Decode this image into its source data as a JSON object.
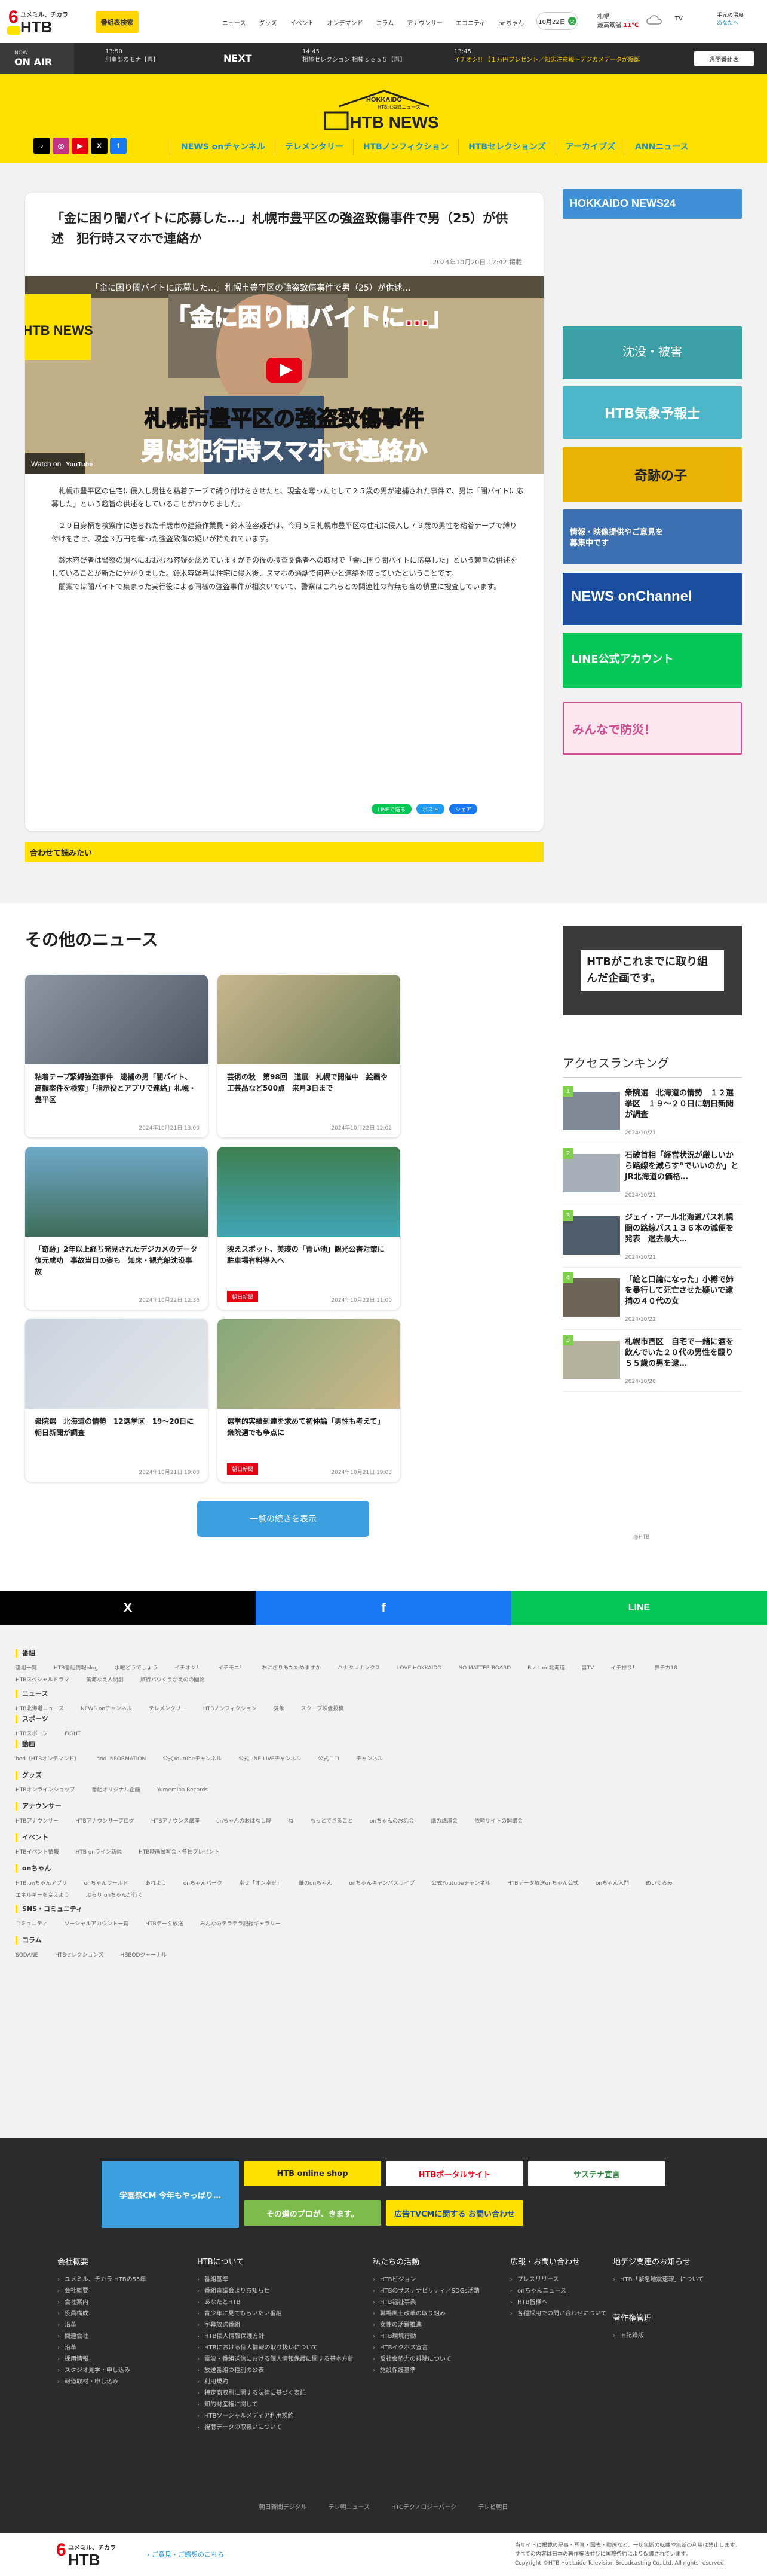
{
  "header": {
    "logo_small": "ユメミル、チカラ",
    "logo_main": "HTB",
    "subscribe_label": "番組表検索",
    "nav": [
      "ニュース",
      "グッズ",
      "イベント",
      "オンデマンド",
      "コラム",
      "アナウンサー",
      "エコニティ",
      "onちゃん"
    ],
    "date": "10月22日",
    "date_badge": "火",
    "weather_place": "札幌",
    "weather_label": "最高気温",
    "weather_temp": "11℃",
    "tv_label": "TV",
    "user_lines": [
      "手元の温度",
      "あなたへ"
    ]
  },
  "onair": {
    "now": "NOW",
    "label": "ON AIR",
    "current_time": "13:50",
    "current_title": "刑事部のモナ",
    "current_tag": "【再】",
    "next_label": "NEXT",
    "next_time": "14:45",
    "next_title": "相棒セレクション 相棒ｓｅａ５",
    "next_tag": "【再】",
    "ticker_time": "13:45",
    "ticker_text": "イチオシ!! 【１万円プレゼント／知床注意報～デジカメデータが爆誕",
    "schedule_button": "週間番組表"
  },
  "brand": {
    "hokkaido": "HOKKAIDO",
    "tagline": "HTB北海道ニュース",
    "newslogo": "HTB NEWS"
  },
  "social": [
    "tiktok",
    "instagram",
    "youtube",
    "x",
    "facebook"
  ],
  "mainnav": [
    "NEWS onチャンネル",
    "テレメンタリー",
    "HTBノンフィクション",
    "HTBセレクションズ",
    "アーカイブズ",
    "ANNニュース"
  ],
  "article": {
    "title": "「金に困り闇バイトに応募した…」札幌市豊平区の強盗致傷事件で男（25）が供述　犯行時スマホで連絡か",
    "date": "2024年10月20日 12:42 掲載",
    "video_title": "「金に困り闇バイトに応募した…」札幌市豊平区の強盗致傷事件で男（25）が供述…",
    "video_caption_top": "「金に困り闇バイトに…」",
    "video_caption_mid": "札幌市豊平区の強盗致傷事件",
    "video_caption_bottom": "男は犯行時スマホで連絡か",
    "video_watch": "Watch on",
    "video_youtube": "YouTube",
    "video_logo": "HTB NEWS",
    "paragraphs": [
      "札幌市豊平区の住宅に侵入し男性を粘着テープで縛り付けをさせたと、現金を奪ったとして２５歳の男が逮捕された事件で、男は「闇バイトに応募した」という趣旨の供述をしていることがわかりました。",
      "２０日身柄を検察庁に送られた千歳市の建築作業員・鈴木陸容疑者は、今月５日札幌市豊平区の住宅に侵入し７９歳の男性を粘着テープで縛り付けをさせ、現金３万円を奪った強盗致傷の疑いが持たれています。",
      "鈴木容疑者は警察の調べにおおむね容疑を認めていますがその後の捜査関係者への取材で「金に困り闇バイトに応募した」という趣旨の供述をしていることが新たに分かりました。鈴木容疑者は住宅に侵入後、スマホの通話で何者かと連絡を取っていたということです。",
      "闇案では闇バイトで集まった実行役による同様の強盗事件が相次いでいて、警察はこれらとの関連性の有無も含め慎重に捜査しています。"
    ],
    "share": [
      "LINEで送る",
      "ポスト",
      "シェア"
    ]
  },
  "related_label": "合わせて読みたい",
  "right_banners": [
    "HOKKAIDO NEWS24",
    "沈没・被害",
    "HTB気象予報士",
    "奇跡の子",
    "情報・映像提供やご意見を募集中です",
    "NEWS onChannel",
    "LINE公式アカウント",
    "みんなで防災！"
  ],
  "other": {
    "title": "その他のニュース",
    "more_button": "一覧の続きを表示",
    "cards": [
      {
        "title": "粘着テープ緊縛強盗事件　逮捕の男「闇バイト、高額案件を検索」「指示役とアプリで連絡」札幌・豊平区",
        "date": "2024年10月21日 13:00",
        "tag": ""
      },
      {
        "title": "芸術の秋　第98回　道展　札幌で開催中　絵画や工芸品など500点　来月3日まで",
        "date": "2024年10月22日 12:02",
        "tag": ""
      },
      {
        "title": "「奇跡」2年以上経ち発見されたデジカメのデータ復元成功　事故当日の姿も　知床・観光船沈没事故",
        "date": "2024年10月22日 12:36",
        "tag": ""
      },
      {
        "title": "映えスポット、美瑛の「青い池」観光公害対策に駐車場有料導入へ",
        "date": "2024年10月22日 11:00",
        "tag": "朝日新聞"
      },
      {
        "title": "衆院選　北海道の情勢　12選挙区　19～20日に朝日新聞が調査",
        "date": "2024年10月21日 19:00",
        "tag": ""
      },
      {
        "title": "選挙的実績到達を求めて初仲論「男性も考えて」衆院選でも争点に",
        "date": "2024年10月21日 19:03",
        "tag": "朝日新聞"
      }
    ]
  },
  "ranking": {
    "banner": "HTBがこれまでに取り組んだ企画です。",
    "title": "アクセスランキング",
    "items": [
      {
        "num": "1",
        "title": "衆院選　北海道の情勢　１２選挙区　１９～２０日に朝日新聞が調査",
        "date": "2024/10/21"
      },
      {
        "num": "2",
        "title": "石破首相「経営状況が厳しいから路線を減らす“でいいのか」と JR北海道の価格…",
        "date": "2024/10/21"
      },
      {
        "num": "3",
        "title": "ジェイ・アール北海道バス札幌圏の路線バス１３６本の減便を発表　過去最大…",
        "date": "2024/10/21"
      },
      {
        "num": "4",
        "title": "「絵と口論になった」小樽で姉を暴行して死亡させた疑いで逮捕の４０代の女",
        "date": "2024/10/22"
      },
      {
        "num": "5",
        "title": "札幌市西区　自宅で一緒に酒を飲んでいた２０代の男性を殴り５５歳の男を逮…",
        "date": "2024/10/20"
      }
    ],
    "footnote": "@HTB"
  },
  "sharebig": [
    "X",
    "f",
    "LINE"
  ],
  "sitemap": [
    {
      "head": "番組",
      "links": [
        "番組一覧",
        "HTB番組情報blog",
        "水曜どうでしょう",
        "イチオシ！",
        "イチモニ！",
        "おにぎりあたためますか",
        "ハナタレナックス",
        "LOVE HOKKAIDO",
        "NO MATTER BOARD",
        "Biz.com北海道",
        "晋TV",
        "イチ推り！",
        "夢チカ18",
        "HTBスペシャルドラマ",
        "黄海なえ人間劇",
        "旅行バウくうかえのの園物"
      ]
    },
    {
      "head": "ニュース",
      "links": [
        "HTB北海道ニュース",
        "NEWS onチャンネル",
        "テレメンタリー",
        "HTBノンフィクション",
        "気象",
        "スクープ映像投稿"
      ]
    },
    {
      "head": "スポーツ",
      "links": [
        "HTBスポーツ",
        "FIGHT"
      ]
    },
    {
      "head": "動画",
      "links": [
        "hod（HTBオンデマンド）",
        "hod INFORMATION",
        "公式Youtubeチャンネル",
        "公式LINE LIVEチャンネル",
        "公式ココ",
        "チャンネル"
      ]
    },
    {
      "head": "グッズ",
      "links": [
        "HTBオンラインショップ",
        "番組オリジナル企画",
        "Yumemiba Records"
      ]
    },
    {
      "head": "アナウンサー",
      "links": [
        "HTBアナウンサー",
        "HTBアナウンサーブログ",
        "HTBアナウンス講座",
        "onちゃんのおはなし隊",
        "ね",
        "もっとできること",
        "onちゃんのお話会",
        "講の講演会",
        "依頼サイトの開講会"
      ]
    },
    {
      "head": "イベント",
      "links": [
        "HTBイベント情報",
        "HTB onライン新規",
        "HTB映画試写会・各種プレゼント"
      ]
    },
    {
      "head": "onちゃん",
      "links": [
        "HTB onちゃんアプリ",
        "onちゃんワールド",
        "あれよう",
        "onちゃんパーク",
        "幸せ「オン幸ゼ」",
        "華のonちゃん",
        "onちゃんキャンパスライブ",
        "公式Youtubeチャンネル",
        "HTBデータ放送onちゃん公式",
        "onちゃん入門",
        "ぬいぐるみ",
        "エネルギーを変えよう",
        "ぶらり onちゃんが行く"
      ]
    },
    {
      "head": "SNS・コミュニティ",
      "links": [
        "コミュニティ",
        "ソーシャルアカウント一覧",
        "HTBデータ放送",
        "みんなのテラテラ記録ギャラリー"
      ]
    },
    {
      "head": "コラム",
      "links": [
        "SODANE",
        "HTBセレクションズ",
        "HBBODジャーナル"
      ]
    }
  ],
  "footer": {
    "banners": [
      "学園祭CM 今年もやっぱり…",
      "HTB online shop",
      "HTBポータルサイト",
      "サステナ宣言",
      "その道のプロが、きます。",
      "広告TVCMに関する お問い合わせ"
    ],
    "columns": [
      {
        "head": "会社概要",
        "items": [
          "ユメミル、チカラ HTBの55年",
          "会社概要",
          "会社案内",
          "役員構成",
          "沿革",
          "関連会社",
          "沿革",
          "採用情報",
          "スタジオ見学・申し込み",
          "報道取材・申し込み"
        ]
      },
      {
        "head": "HTBについて",
        "items": [
          "番組基準",
          "番組審議会よりお知らせ",
          "あなたとHTB",
          "青少年に見てもらいたい番組",
          "字幕放送番組",
          "HTB個人情報保護方針",
          "HTBにおける個人情報の取り扱いについて",
          "電波・番組送信における個人情報保護に関する基本方針",
          "放送番組の種別の公表",
          "利用規約",
          "特定商取引に関する法律に基づく表記",
          "知的財産権に関して",
          "HTBソーシャルメディア利用規約",
          "視聴データの取扱いについて"
        ]
      },
      {
        "head": "私たちの活動",
        "items": [
          "HTBビジョン",
          "HTBのサステナビリティ／SDGs活動",
          "HTB福祉事業",
          "職場風土改革の取り組み",
          "女性の活躍推進",
          "HTB環境行動",
          "HTBイクボス宣言",
          "反社会勢力の排除について",
          "施設保護基準"
        ]
      },
      {
        "head": "広報・お問い合わせ",
        "items": [
          "プレスリリース",
          "onちゃんニュース",
          "HTB皆様へ",
          "各種採用での問い合わせについて"
        ]
      },
      {
        "head": "地デジ関連のお知らせ",
        "items": [
          "HTB「緊急地震速報」について"
        ]
      },
      {
        "head": "著作権管理",
        "items": [
          "旧記録版"
        ]
      }
    ],
    "bottom_links": [
      "朝日新聞デジタル",
      "テレ朝ニュース",
      "HTCテクノロジーパーク",
      "テレビ朝日"
    ],
    "copyright_lines": [
      "当サイトに掲載の記事・写真・図表・動画など、一切無断の転載や無断の利用は禁止します。",
      "すべての内容は日本の著作権法並びに国際条約により保護されています。"
    ],
    "privacy_link": "ご意見・ご感想のこちら",
    "copyright": "Copyright ©HTB Hokkaido Television Broadcasting Co.,Ltd. All rights reserved."
  },
  "colors": {
    "brand_yellow": "#ffe100",
    "nav_blue": "#1a8fd8",
    "accent_red": "#e60012",
    "onair_dark": "#2a2a2a",
    "rank_green": "#7fd04a",
    "more_blue": "#3aa0e0"
  }
}
